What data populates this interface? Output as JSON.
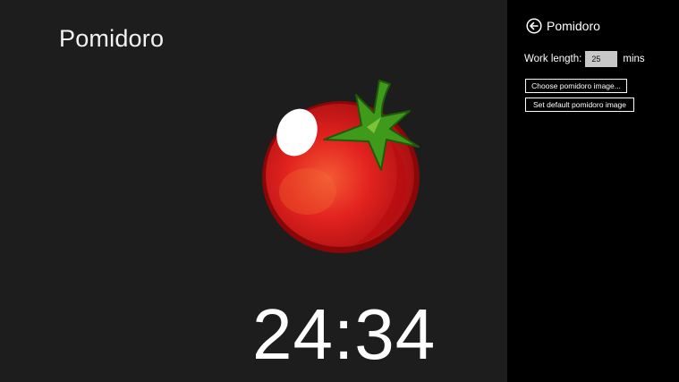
{
  "app": {
    "title": "Pomidoro"
  },
  "timer": {
    "display": "24:34"
  },
  "settings": {
    "title": "Pomidoro",
    "work_length_label": "Work length:",
    "work_length_value": "25",
    "work_length_unit": "mins",
    "choose_image_label": "Choose pomidoro image...",
    "default_image_label": "Set default pomidoro image"
  },
  "icons": {
    "back": "back-arrow-circle-icon",
    "tomato": "tomato-image"
  },
  "colors": {
    "main_bg": "#1d1d1d",
    "pane_bg": "#000000",
    "tomato_red": "#e3211f",
    "stem_green": "#3f9a1c",
    "text": "#ffffff"
  }
}
